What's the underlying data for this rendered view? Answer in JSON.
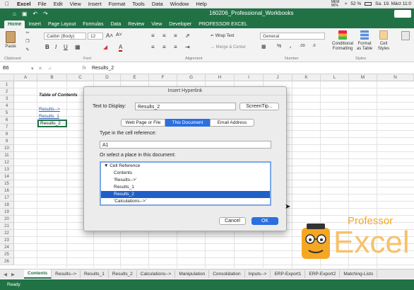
{
  "menubar": {
    "apple": "",
    "app": "Excel",
    "items": [
      "File",
      "Edit",
      "View",
      "Insert",
      "Format",
      "Tools",
      "Data",
      "Window",
      "Help"
    ],
    "mem": "MEM 96%",
    "battery": "52 %",
    "datetime": "Sa. 19. März  11:0"
  },
  "titlebar": {
    "title": "160206_Professional_Workbooks"
  },
  "ribbon": {
    "tabs": [
      "Home",
      "Insert",
      "Page Layout",
      "Formulas",
      "Data",
      "Review",
      "View",
      "Developer",
      "PROFESSOR EXCEL"
    ],
    "paste": "Paste",
    "clipboard": "Clipboard",
    "font_name": "Calibri (Body)",
    "font_size": "12",
    "font_group": "Font",
    "wrap_text": "Wrap Text",
    "merge_center": "Merge & Center",
    "alignment": "Alignment",
    "number_format": "General",
    "number": "Number",
    "conditional": "Conditional Formatting",
    "format_table": "Format as Table",
    "cell_styles": "Cell Styles",
    "styles": "Styles"
  },
  "formula_bar": {
    "cell_ref": "B6",
    "fx": "fx",
    "value": "Results_2"
  },
  "grid": {
    "columns": [
      "A",
      "B",
      "C",
      "D",
      "E",
      "F",
      "G",
      "H",
      "I",
      "J",
      "K",
      "L",
      "M",
      "N"
    ],
    "rows": [
      "1",
      "2",
      "3",
      "4",
      "5",
      "6",
      "7",
      "8",
      "9",
      "10",
      "11",
      "12",
      "13",
      "14",
      "15",
      "16",
      "17",
      "18",
      "19",
      "20",
      "21",
      "22",
      "23",
      "24",
      "25",
      "26"
    ],
    "b2": "Table of Contents",
    "b4": "Results-->",
    "b5": "Results_1",
    "b6": "Results_2"
  },
  "dialog": {
    "title": "Insert Hyperlink",
    "text_to_display_label": "Text to Display:",
    "text_to_display_value": "Results_2",
    "screentip": "ScreenTip...",
    "tabs": [
      "Web Page or File",
      "This Document",
      "Email Address"
    ],
    "cell_ref_label": "Type in the cell reference:",
    "cell_ref_value": "A1",
    "place_label": "Or select a place in this document:",
    "list": [
      "▼ Cell Reference",
      "Contents",
      "'Results-->'",
      "Results_1",
      "Results_2",
      "'Calculations-->'"
    ],
    "cancel": "Cancel",
    "ok": "OK"
  },
  "sheets": [
    "Contents",
    "Results-->",
    "Results_1",
    "Results_2",
    "Calculations-->",
    "Manipulation",
    "Consolidation",
    "Inputs-->",
    "ERP-Export1",
    "ERP-Export2",
    "Matching-Lists"
  ],
  "status": "Ready",
  "logo": {
    "word1": "Professor",
    "word2": "Excel"
  },
  "colors": {
    "excel_green": "#207245",
    "selection_blue": "#1f5fc8",
    "logo_orange": "#f5a623"
  }
}
